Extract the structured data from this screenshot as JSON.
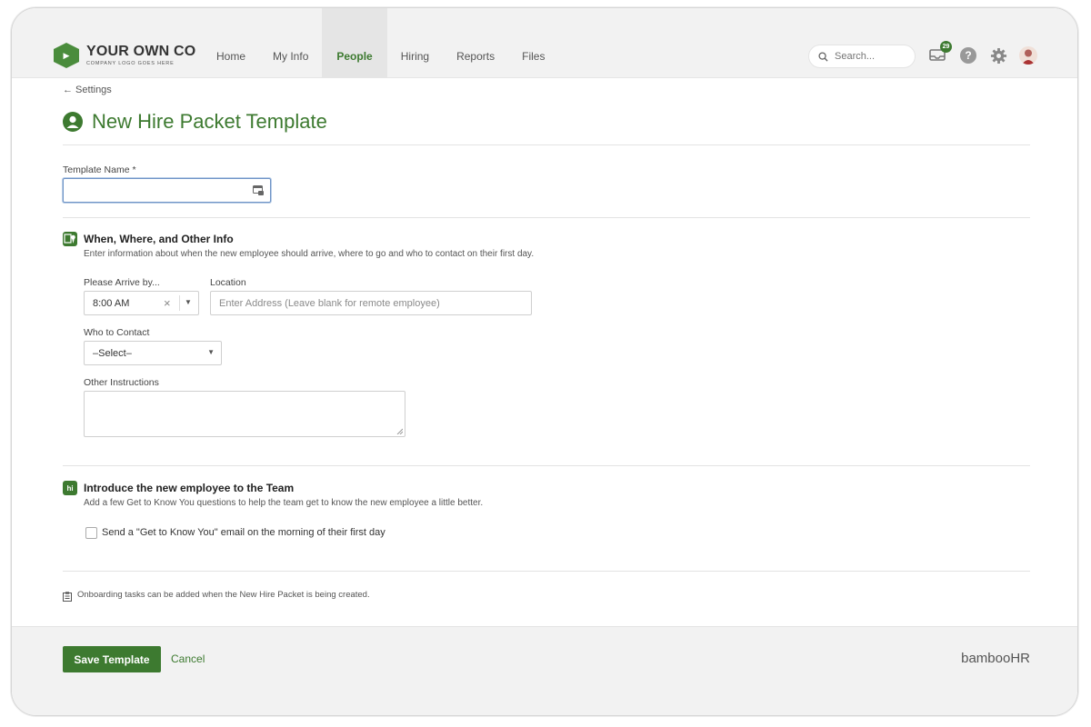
{
  "header": {
    "logo_main": "YOUR OWN CO",
    "logo_sub": "COMPANY LOGO GOES HERE",
    "nav": [
      "Home",
      "My Info",
      "People",
      "Hiring",
      "Reports",
      "Files"
    ],
    "active_nav": "People",
    "search_placeholder": "Search...",
    "notification_count": "29",
    "help_label": "?"
  },
  "breadcrumb": {
    "back_label": "← Settings"
  },
  "page": {
    "title": "New Hire Packet Template"
  },
  "template_name": {
    "label": "Template Name *",
    "value": ""
  },
  "section_when": {
    "title": "When, Where, and Other Info",
    "description": "Enter information about when the new employee should arrive, where to go and who to contact on their first day.",
    "arrive_label": "Please Arrive by...",
    "arrive_value": "8:00 AM",
    "location_label": "Location",
    "location_placeholder": "Enter Address (Leave blank for remote employee)",
    "contact_label": "Who to Contact",
    "contact_value": "–Select–",
    "instructions_label": "Other Instructions",
    "instructions_value": ""
  },
  "section_intro": {
    "icon_text": "hi",
    "title": "Introduce the new employee to the Team",
    "description": "Add a few Get to Know You questions to help the team get to know the new employee a little better.",
    "checkbox_label": "Send a \"Get to Know You\" email on the morning of their first day",
    "checkbox_checked": false
  },
  "note": "Onboarding tasks can be added when the New Hire Packet is being created.",
  "footer": {
    "save_label": "Save Template",
    "cancel_label": "Cancel",
    "brand": "bambooHR"
  },
  "colors": {
    "accent": "#3d7a30",
    "logo": "#4a8c3c"
  }
}
